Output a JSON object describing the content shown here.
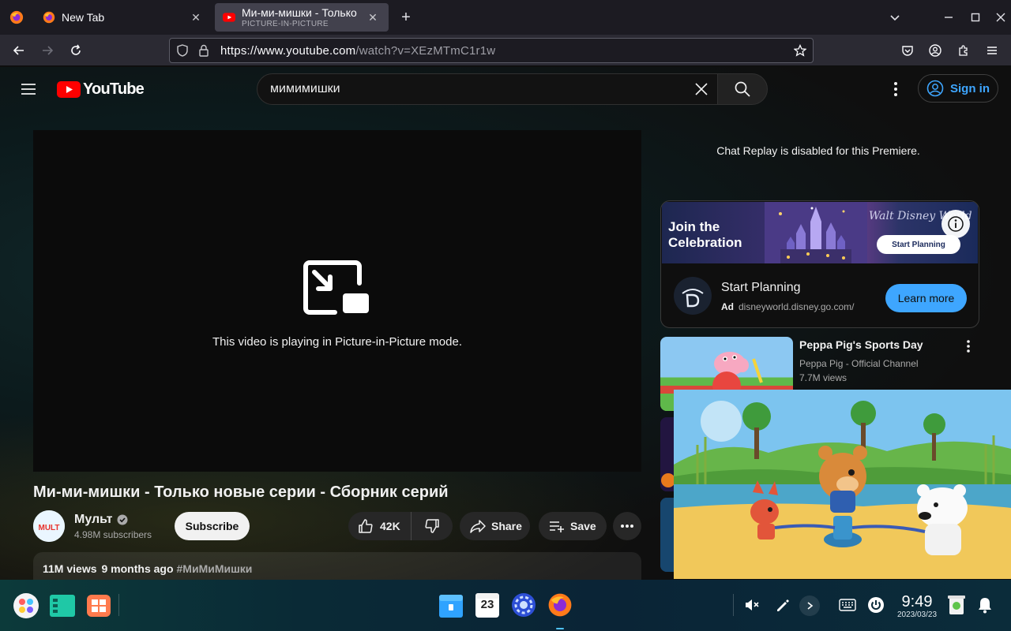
{
  "browser": {
    "tabs": [
      {
        "title": "New Tab",
        "active": false
      },
      {
        "title": "Ми-ми-мишки - Только",
        "subtitle": "PICTURE-IN-PICTURE",
        "active": true
      }
    ],
    "url_host": "https://www.youtube.com",
    "url_path": "/watch?v=XEzMTmC1r1w"
  },
  "youtube": {
    "logo_text": "YouTube",
    "search_query": "мимимишки",
    "sign_in_label": "Sign in",
    "player": {
      "pip_message": "This video is playing in Picture-in-Picture mode."
    },
    "video": {
      "title": "Ми-ми-мишки - Только новые серии - Сборник серий",
      "channel_name": "Мульт",
      "subscribers": "4.98M subscribers",
      "subscribe_label": "Subscribe",
      "likes": "42K",
      "share_label": "Share",
      "save_label": "Save",
      "views": "11M views",
      "age": "9 months ago",
      "hashtag": "#МиМиМишки"
    },
    "sidebar": {
      "chat_replay": "Chat Replay is disabled for this Premiere.",
      "ad": {
        "banner_headline_1": "Join the",
        "banner_headline_2": "Celebration",
        "banner_cta": "Start Planning",
        "title": "Start Planning",
        "badge": "Ad",
        "domain": "disneyworld.disney.go.com/",
        "button_label": "Learn more"
      },
      "recommendations": [
        {
          "title": "Peppa Pig's Sports Day",
          "channel": "Peppa Pig - Official Channel",
          "views": "7.7M views"
        }
      ]
    }
  },
  "taskbar": {
    "clock_time": "9:49",
    "clock_date": "2023/03/23",
    "calendar_day": "23"
  },
  "colors": {
    "yt_red": "#ff0000",
    "link_blue": "#3ea6ff",
    "ff_tab_active": "#42414d"
  }
}
